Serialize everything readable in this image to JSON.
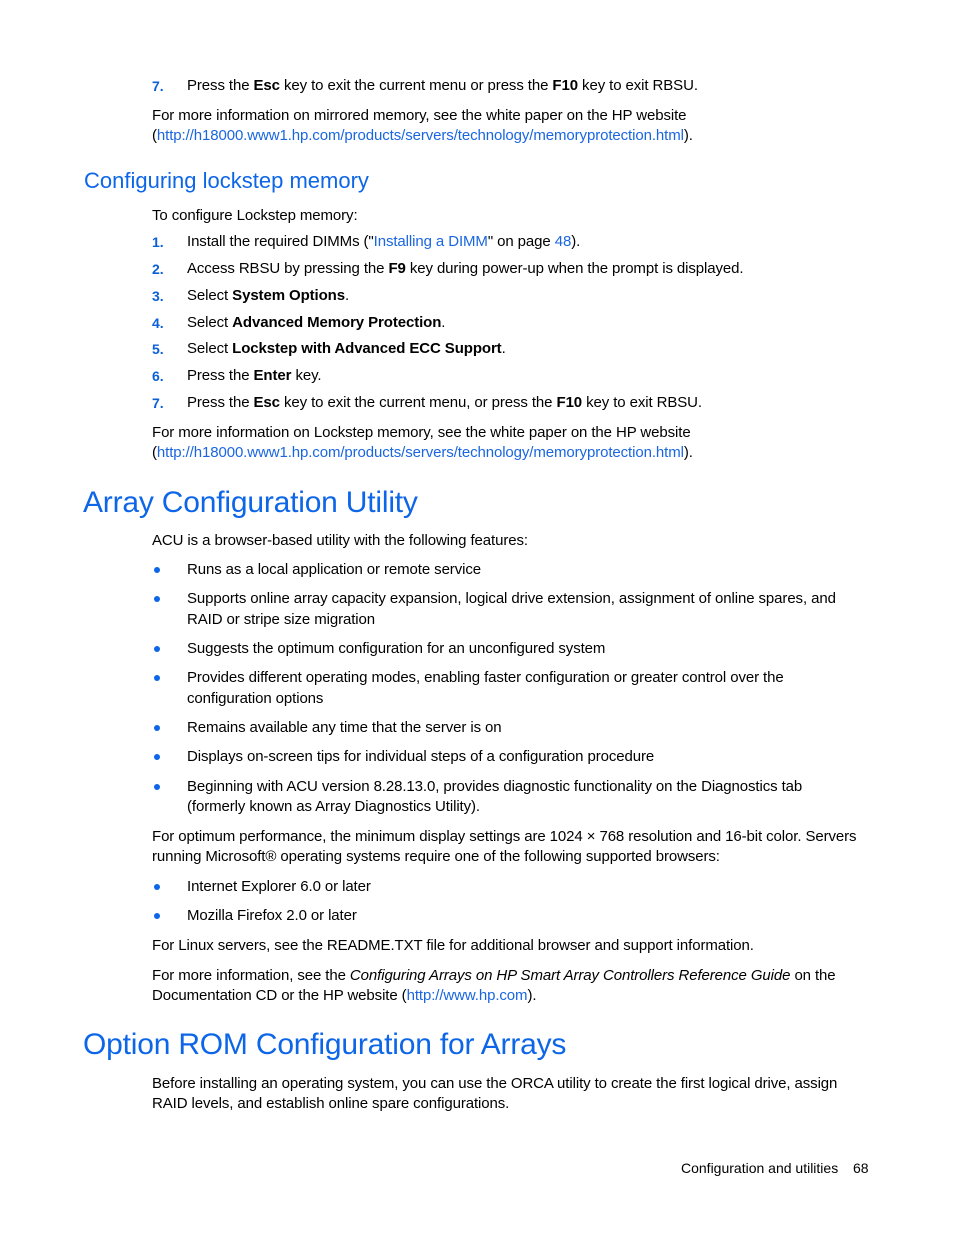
{
  "top": {
    "step7_num": "7.",
    "step7_a": "Press the ",
    "step7_key1": "Esc",
    "step7_b": " key to exit the current menu or press the ",
    "step7_key2": "F10",
    "step7_c": " key to exit RBSU.",
    "mirror_text": "For more information on mirrored memory, see the white paper on the HP website",
    "mirror_open": "(",
    "mirror_link": "http://h18000.www1.hp.com/products/servers/technology/memoryprotection.html",
    "mirror_close": ")."
  },
  "lockstep": {
    "heading": "Configuring lockstep memory",
    "intro": "To configure Lockstep memory:",
    "steps": [
      {
        "num": "1.",
        "a": "Install the required DIMMs (\"",
        "link": "Installing a DIMM",
        "b": "\" on page ",
        "page_link": "48",
        "c": ")."
      },
      {
        "num": "2.",
        "a": "Access RBSU by pressing the ",
        "bold": "F9",
        "b": " key during power-up when the prompt is displayed."
      },
      {
        "num": "3.",
        "a": "Select ",
        "bold": "System Options",
        "b": "."
      },
      {
        "num": "4.",
        "a": "Select ",
        "bold": "Advanced Memory Protection",
        "b": "."
      },
      {
        "num": "5.",
        "a": "Select ",
        "bold": "Lockstep with Advanced ECC Support",
        "b": "."
      },
      {
        "num": "6.",
        "a": "Press the ",
        "bold": "Enter",
        "b": " key."
      },
      {
        "num": "7.",
        "a": "Press the ",
        "bold": "Esc",
        "b": " key to exit the current menu, or press the ",
        "bold2": "F10",
        "c": " key to exit RBSU."
      }
    ],
    "more_text": "For more information on Lockstep memory, see the white paper on the HP website",
    "more_open": "(",
    "more_link": "http://h18000.www1.hp.com/products/servers/technology/memoryprotection.html",
    "more_close": ")."
  },
  "acu": {
    "heading": "Array Configuration Utility",
    "intro": "ACU is a browser-based utility with the following features:",
    "features": [
      [
        "Runs as a local application or remote service"
      ],
      [
        "Supports online array capacity expansion, logical drive extension, assignment of online spares, and",
        "RAID or stripe size migration"
      ],
      [
        "Suggests the optimum configuration for an unconfigured system"
      ],
      [
        "Provides different operating modes, enabling faster configuration or greater control over the",
        "configuration options"
      ],
      [
        "Remains available any time that the server is on"
      ],
      [
        "Displays on-screen tips for individual steps of a configuration procedure"
      ],
      [
        "Beginning with ACU version 8.28.13.0, provides diagnostic functionality on the Diagnostics tab",
        "(formerly known as Array Diagnostics Utility)."
      ]
    ],
    "perf_line1": "For optimum performance, the minimum display settings are 1024 × 768 resolution and 16-bit color. Servers",
    "perf_line2": "running Microsoft® operating systems require one of the following supported browsers:",
    "browsers": [
      "Internet Explorer 6.0 or later",
      "Mozilla Firefox 2.0 or later"
    ],
    "linux": "For Linux servers, see the README.TXT file for additional browser and support information.",
    "more_a": "For more information, see the ",
    "more_italic": "Configuring Arrays on HP Smart Array Controllers Reference Guide",
    "more_b": " on the",
    "more_line2_a": "Documentation CD or the HP website (",
    "more_link": "http://www.hp.com",
    "more_line2_b": ")."
  },
  "orca": {
    "heading": "Option ROM Configuration for Arrays",
    "line1": "Before installing an operating system, you can use the ORCA utility to create the first logical drive, assign",
    "line2": "RAID levels, and establish online spare configurations."
  },
  "footer": {
    "section": "Configuration and utilities",
    "page": "68"
  }
}
